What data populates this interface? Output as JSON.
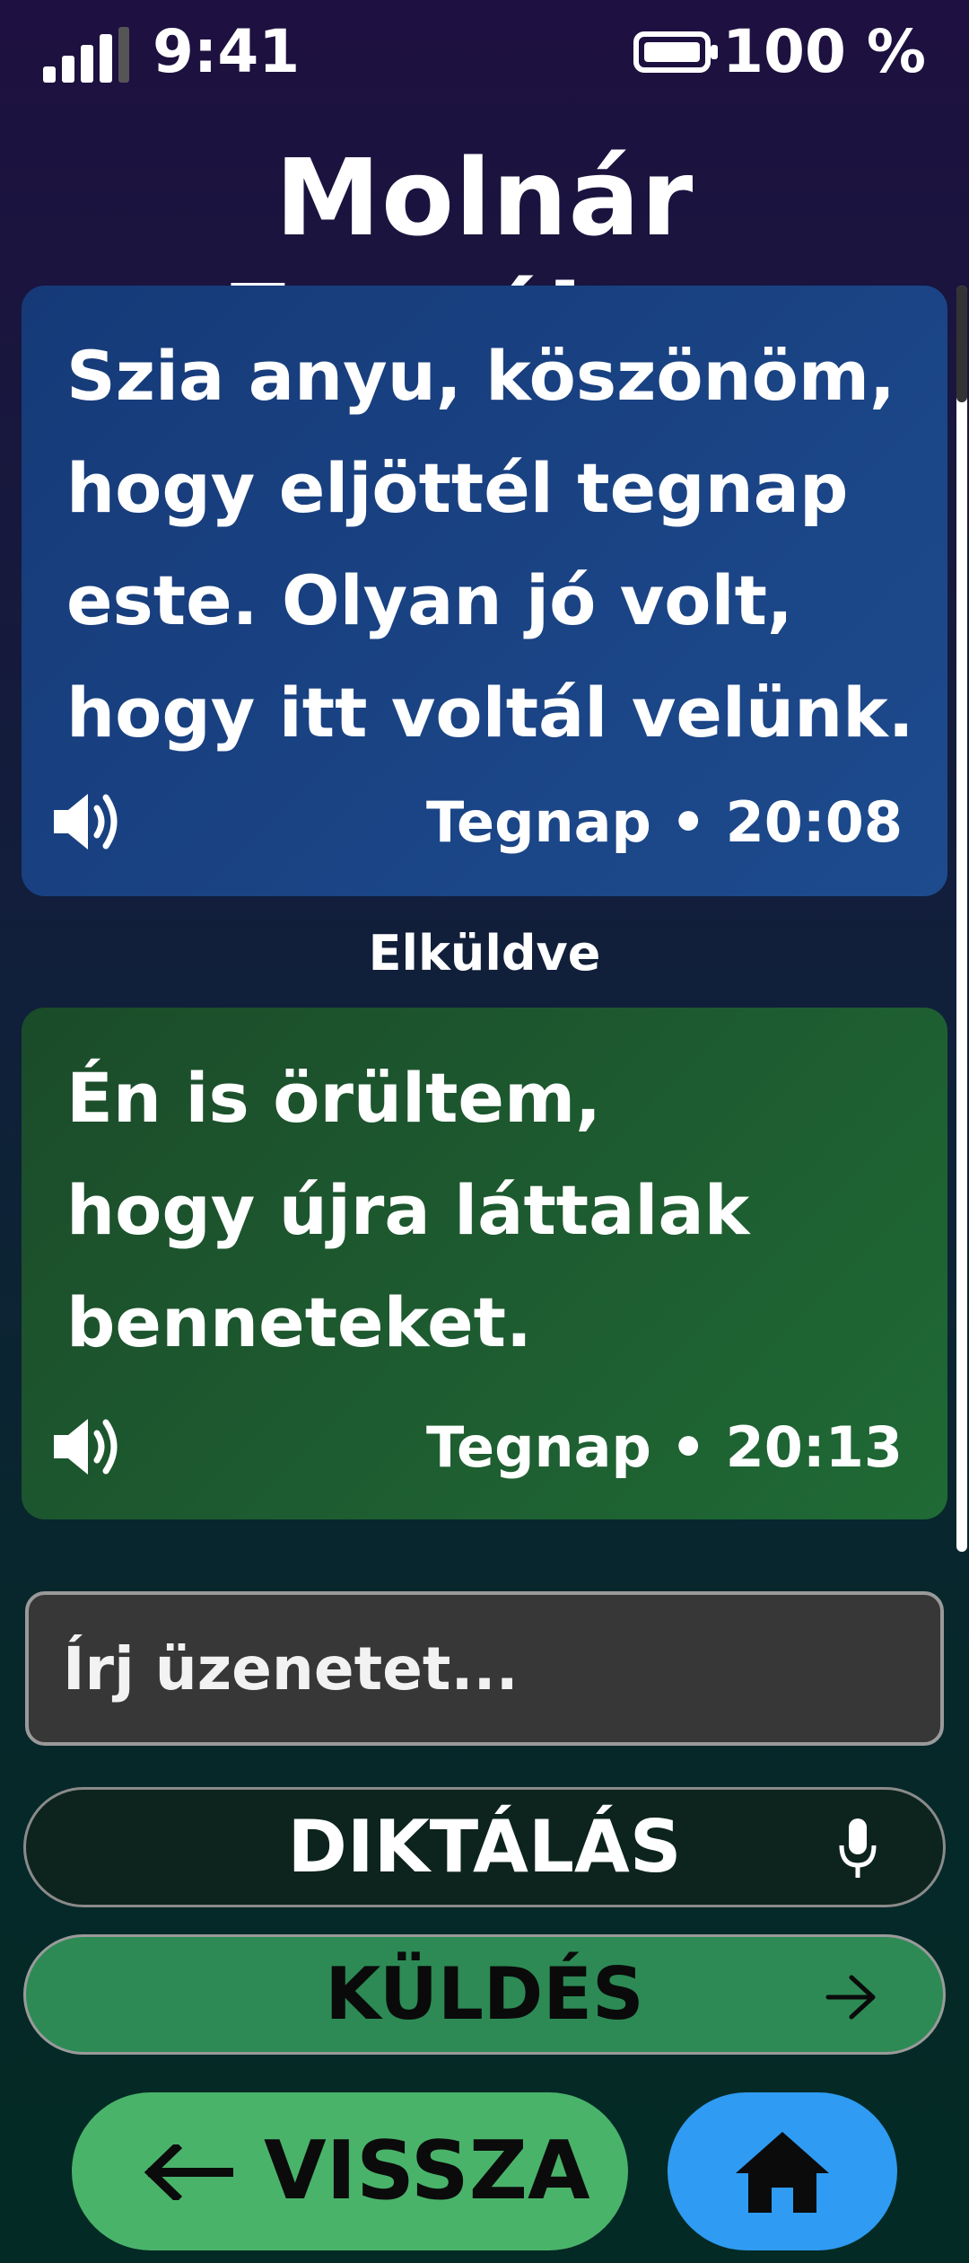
{
  "status_bar": {
    "time": "9:41",
    "battery_percent": "100 %",
    "signal_icon": "signal-bars-icon",
    "battery_icon": "battery-icon"
  },
  "header": {
    "contact_name": "Molnár Erzsébet"
  },
  "messages": [
    {
      "direction": "incoming",
      "text": "Szia anyu, köszönöm,\nhogy eljöttél tegnap\neste. Olyan jó volt,\nhogy itt voltál velünk.",
      "timestamp": "Tegnap • 20:08",
      "icon": "speaker-icon",
      "color": "#1a4383"
    },
    {
      "direction": "outgoing",
      "status": "Elküldve",
      "text": "Én is örültem,\nhogy újra láttalak\nbenneteket.",
      "timestamp": "Tegnap • 20:13",
      "icon": "speaker-icon",
      "color": "#1e5c30"
    }
  ],
  "composer": {
    "placeholder": "Írj üzenetet...",
    "value": "",
    "dictate_label": "DIKTÁLÁS",
    "dictate_icon": "microphone-icon",
    "send_label": "KÜLDÉS",
    "send_icon": "arrow-right-icon"
  },
  "bottom_nav": {
    "back_label": "VISSZA",
    "back_icon": "arrow-left-icon",
    "home_icon": "home-icon"
  },
  "colors": {
    "send_button": "#2d8a55",
    "back_button": "#4ab36a",
    "home_button": "#2f9bf2",
    "input_background": "#373737"
  }
}
